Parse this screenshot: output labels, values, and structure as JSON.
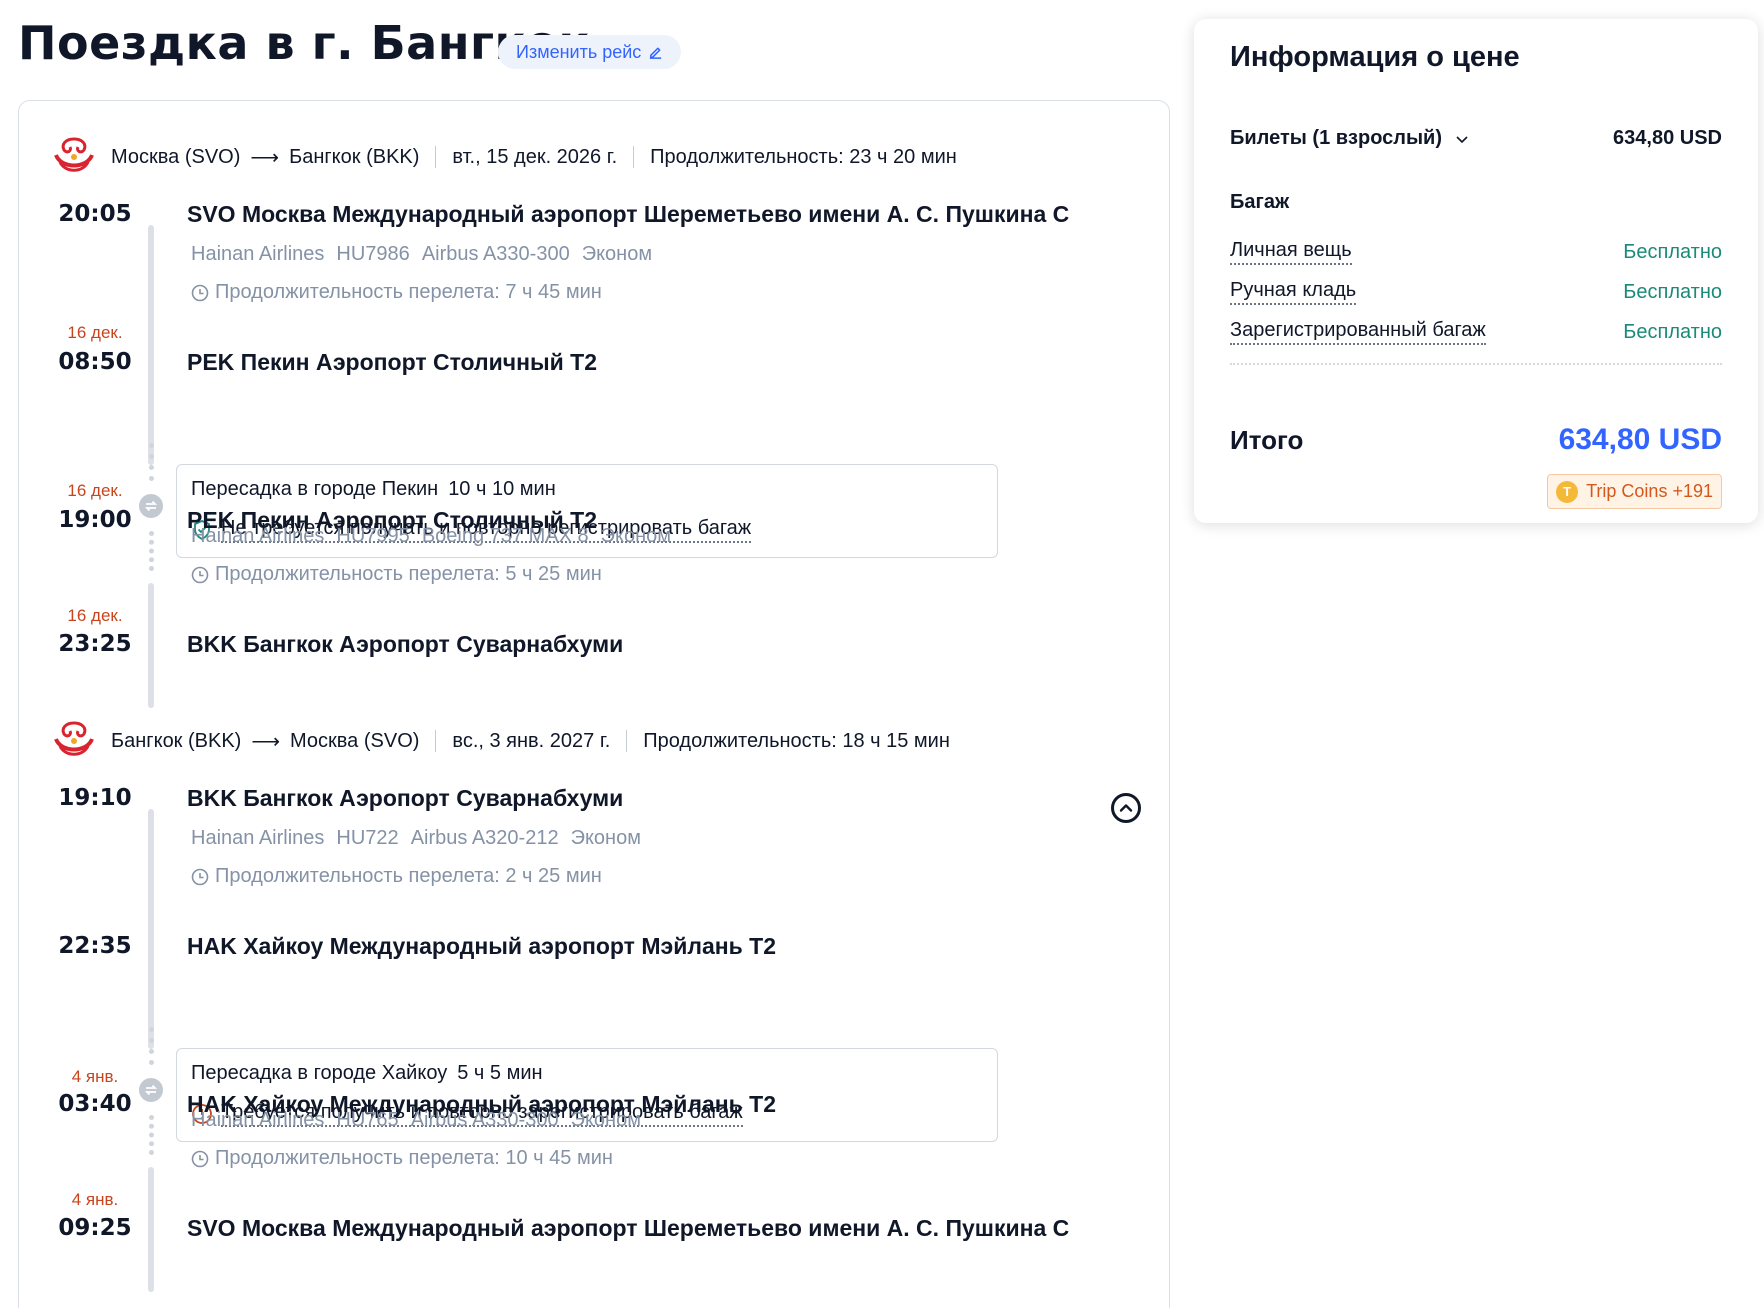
{
  "header": {
    "title": "Поездка в г. Бангкок",
    "change_label": "Изменить рейс"
  },
  "outbound": {
    "from": "Москва (SVO)",
    "to": "Бангкок (BKK)",
    "date": "вт., 15 дек. 2026 г.",
    "total_duration": "Продолжительность: 23 ч 20 мин",
    "leg1": {
      "dep_time": "20:05",
      "dep_airport": "SVO Москва Международный аэропорт Шереметьево имени А. С. Пушкина C",
      "airline": "Hainan Airlines",
      "flight": "HU7986",
      "aircraft": "Airbus A330-300",
      "cabin": "Эконом",
      "duration": "Продолжительность перелета: 7 ч 45 мин",
      "arr_note": "16 дек.",
      "arr_time": "08:50",
      "arr_airport": "PEK Пекин Аэропорт Столичный T2"
    },
    "transfer": {
      "city": "Пересадка в городе Пекин",
      "duration": "10 ч 10 мин",
      "note": "Не требуется получать и повторно регистрировать багаж"
    },
    "leg2": {
      "dep_note": "16 дек.",
      "dep_time": "19:00",
      "dep_airport": "PEK Пекин Аэропорт Столичный T2",
      "airline": "Hainan Airlines",
      "flight": "HU7995",
      "aircraft": "Boeing 737 MAX 8",
      "cabin": "Эконом",
      "duration": "Продолжительность перелета: 5 ч 25 мин",
      "arr_note": "16 дек.",
      "arr_time": "23:25",
      "arr_airport": "BKK Бангкок Аэропорт Суварнабхуми"
    }
  },
  "inbound": {
    "from": "Бангкок (BKK)",
    "to": "Москва (SVO)",
    "date": "вс., 3 янв. 2027 г.",
    "total_duration": "Продолжительность: 18 ч 15 мин",
    "leg1": {
      "dep_time": "19:10",
      "dep_airport": "BKK Бангкок Аэропорт Суварнабхуми",
      "airline": "Hainan Airlines",
      "flight": "HU722",
      "aircraft": "Airbus A320-212",
      "cabin": "Эконом",
      "duration": "Продолжительность перелета: 2 ч 25 мин",
      "arr_time": "22:35",
      "arr_airport": "HAK Хайкоу Международный аэропорт Мэйлань T2"
    },
    "transfer": {
      "city": "Пересадка в городе Хайкоу",
      "duration": "5 ч 5 мин",
      "note": "Требуется получить и повторно зарегистрировать багаж"
    },
    "leg2": {
      "dep_note": "4 янв.",
      "dep_time": "03:40",
      "dep_airport": "HAK Хайкоу Международный аэропорт Мэйлань T2",
      "airline": "Hainan Airlines",
      "flight": "HU765",
      "aircraft": "Airbus A330-300",
      "cabin": "Эконом",
      "duration": "Продолжительность перелета: 10 ч 45 мин",
      "arr_note": "4 янв.",
      "arr_time": "09:25",
      "arr_airport": "SVO Москва Международный аэропорт Шереметьево имени А. С. Пушкина C"
    }
  },
  "price": {
    "title": "Информация о цене",
    "tickets_label": "Билеты (1 взрослый)",
    "tickets_value": "634,80 USD",
    "baggage_title": "Багаж",
    "baggage": [
      {
        "name": "Личная вещь",
        "value": "Бесплатно"
      },
      {
        "name": "Ручная кладь",
        "value": "Бесплатно"
      },
      {
        "name": "Зарегистрированный багаж",
        "value": "Бесплатно"
      }
    ],
    "total_label": "Итого",
    "total_value": "634,80 USD",
    "coins_label": "Trip Coins +191",
    "coin_symbol": "T"
  },
  "colors": {
    "accent": "#3264ff",
    "free": "#1a8a7a",
    "warning": "#c8441c"
  }
}
